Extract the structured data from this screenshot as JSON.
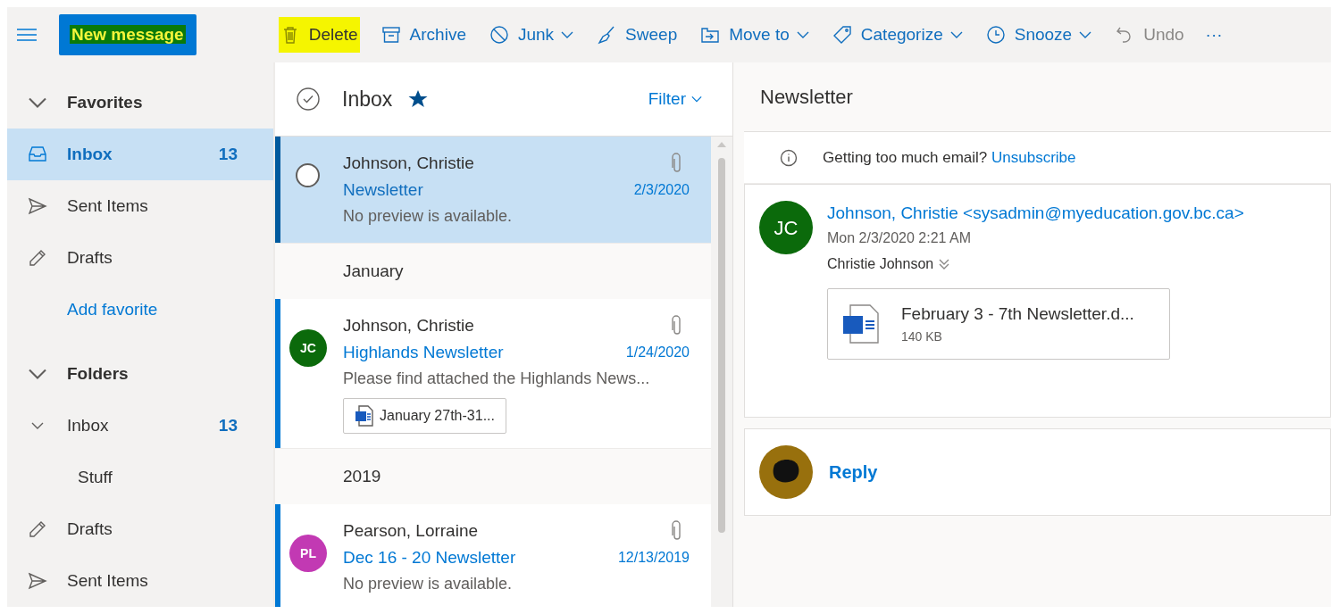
{
  "toolbar": {
    "new_message": {
      "label": "New message",
      "highlighted": true
    },
    "actions": [
      {
        "kind": "delete",
        "label": "Delete",
        "dropdown": false,
        "disabled": false,
        "highlighted": true
      },
      {
        "kind": "archive",
        "label": "Archive",
        "dropdown": false,
        "disabled": false,
        "highlighted": false
      },
      {
        "kind": "junk",
        "label": "Junk",
        "dropdown": true,
        "disabled": false,
        "highlighted": false
      },
      {
        "kind": "sweep",
        "label": "Sweep",
        "dropdown": false,
        "disabled": false,
        "highlighted": false
      },
      {
        "kind": "move",
        "label": "Move to",
        "dropdown": true,
        "disabled": false,
        "highlighted": false
      },
      {
        "kind": "categorize",
        "label": "Categorize",
        "dropdown": true,
        "disabled": false,
        "highlighted": false
      },
      {
        "kind": "snooze",
        "label": "Snooze",
        "dropdown": true,
        "disabled": false,
        "highlighted": false
      },
      {
        "kind": "undo",
        "label": "Undo",
        "dropdown": false,
        "disabled": true,
        "highlighted": false
      }
    ],
    "more": "···"
  },
  "sidebar": {
    "sections": [
      {
        "title": "Favorites",
        "expanded": true,
        "items": [
          {
            "kind": "inbox",
            "label": "Inbox",
            "count": "13",
            "selected": true
          },
          {
            "kind": "sent",
            "label": "Sent Items",
            "selected": false
          },
          {
            "kind": "drafts",
            "label": "Drafts",
            "selected": false
          },
          {
            "kind": "link",
            "label": "Add favorite",
            "selected": false
          }
        ]
      },
      {
        "title": "Folders",
        "expanded": true,
        "items": [
          {
            "label": "Inbox",
            "count": "13",
            "selected": false,
            "expanded": true,
            "children": [
              {
                "label": "Stuff",
                "selected": false
              }
            ]
          },
          {
            "kind": "drafts",
            "label": "Drafts",
            "selected": false
          },
          {
            "kind": "sent",
            "label": "Sent Items",
            "selected": false
          }
        ]
      }
    ]
  },
  "message_list": {
    "title": "Inbox",
    "favorite": true,
    "filter": "Filter",
    "items": [
      {
        "kind": "message",
        "sender": "Johnson, Christie",
        "subject": "Newsletter",
        "date": "2/3/2020",
        "preview": "No preview is available.",
        "attachment": true,
        "selected": true,
        "unread": true
      },
      {
        "kind": "group",
        "label": "January"
      },
      {
        "kind": "message",
        "sender": "Johnson, Christie",
        "subject": "Highlands Newsletter",
        "date": "1/24/2020",
        "preview": "Please find attached the Highlands News...",
        "attachment": true,
        "initials": "JC",
        "color": "#0b6a0b",
        "file": "January 27th-31...",
        "selected": false,
        "unread": true
      },
      {
        "kind": "group",
        "label": "2019"
      },
      {
        "kind": "message",
        "sender": "Pearson, Lorraine",
        "subject": "Dec 16 - 20 Newsletter",
        "date": "12/13/2019",
        "preview": "No preview is available.",
        "attachment": true,
        "initials": "PL",
        "color": "#c239b3",
        "selected": false,
        "unread": true
      }
    ]
  },
  "reading_pane": {
    "subject": "Newsletter",
    "notice": "Getting too much email?",
    "unsubscribe": "Unsubscribe",
    "message": {
      "initials": "JC",
      "color": "#0b6a0b",
      "from": "Johnson, Christie <sysadmin@myeducation.gov.bc.ca>",
      "date": "Mon 2/3/2020 2:21 AM",
      "to": "Christie Johnson",
      "attachment": {
        "name": "February 3 - 7th Newsletter.d...",
        "size": "140 KB"
      }
    },
    "reply": "Reply"
  }
}
